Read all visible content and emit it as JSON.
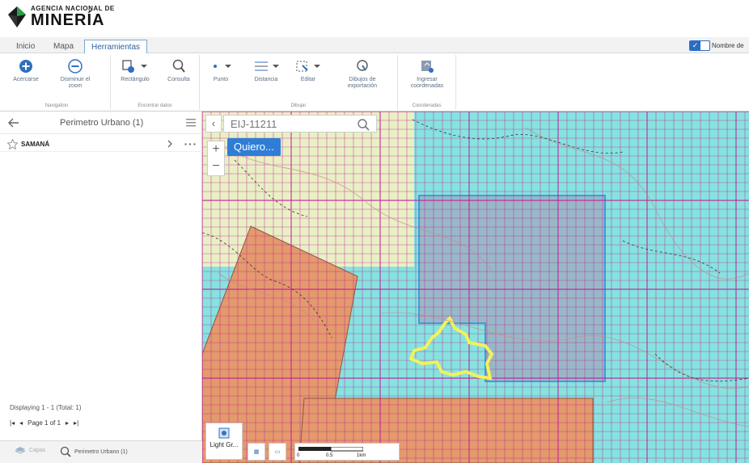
{
  "brand": {
    "line1": "AGENCIA NACIONAL DE",
    "line2": "MINERÍA"
  },
  "tabs": [
    {
      "label": "Inicio"
    },
    {
      "label": "Mapa"
    },
    {
      "label": "Herramientas"
    }
  ],
  "toggle": {
    "label": "Nombre de",
    "checked": true
  },
  "ribbon": {
    "groups": [
      {
        "label": "Navigation",
        "tools": [
          {
            "label": "Acercarse"
          },
          {
            "label": "Disminuir el zoom"
          }
        ]
      },
      {
        "label": "Encontrar datos",
        "tools": [
          {
            "label": "Rectángulo"
          },
          {
            "label": "Consulta"
          }
        ]
      },
      {
        "label": "Dibujar",
        "tools": [
          {
            "label": "Punto"
          },
          {
            "label": "Distancia"
          },
          {
            "label": "Editar"
          },
          {
            "label": "Dibujos de exportación"
          }
        ]
      },
      {
        "label": "Coordenadas",
        "tools": [
          {
            "label": "Ingresar coordenadas"
          }
        ]
      }
    ]
  },
  "panel": {
    "title": "Perimetro Urbano (1)",
    "result": "SAMANÁ",
    "display_info": "Displaying 1 - 1 (Total: 1)",
    "pager_label": "Page 1 of 1",
    "bottom_tabs": [
      {
        "label": "Capas"
      },
      {
        "label": "Perimetro Urbano (1)"
      }
    ]
  },
  "map": {
    "search_placeholder": "EIJ-11211",
    "quiero_label": "Quiero...",
    "basemap_label": "Light Gr...",
    "scale_labels": [
      "0",
      "0.5",
      "1km"
    ]
  },
  "colors": {
    "accent": "#2f7dd6",
    "map_cyan": "#86e3df",
    "grid_magenta": "#c61f9a",
    "parcel_orange": "#e39a6c",
    "parcel_yellow": "#f4f1c2",
    "parcel_gray": "#9ab2c4",
    "outline_yellow": "#f2f25a"
  }
}
